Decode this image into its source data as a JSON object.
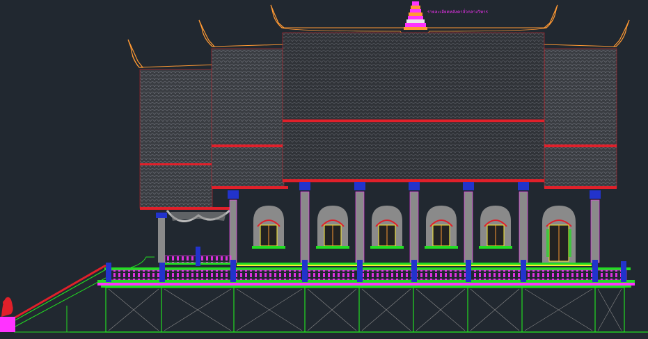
{
  "app": {
    "background": "#212830"
  },
  "annotation": {
    "text": "รายละเอียดหลังคาจั่วกลางวิหาร"
  },
  "colors": {
    "roof_outline": "#ff9933",
    "roof_fill": "#3a3d42",
    "roof_pattern": "#6a6d72",
    "red_band": "#e0202a",
    "magenta": "#ff33ff",
    "green": "#22dd22",
    "blue": "#2233cc",
    "gray": "#8a8a8a",
    "yellow": "#ffee33",
    "cyan": "#33ccff",
    "white": "#e8e8e8"
  },
  "icons": {
    "spire": "spire-icon",
    "column": "column-icon",
    "window": "window-icon",
    "door": "door-icon",
    "post": "balustrade-post-icon",
    "naga": "naga-icon"
  }
}
